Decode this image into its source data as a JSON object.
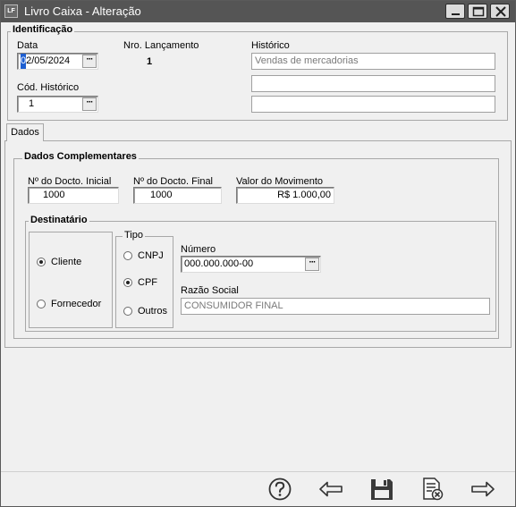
{
  "window": {
    "icon_text": "LF",
    "title": "Livro Caixa - Alteração",
    "controls": [
      "minimize-icon",
      "maximize-icon",
      "close-icon"
    ]
  },
  "identificacao": {
    "group_title": "Identificação",
    "data_label": "Data",
    "data_first": "0",
    "data_rest": "2/05/2024",
    "lancamento_label": "Nro. Lançamento",
    "lancamento_value": "1",
    "historico_label": "Histórico",
    "historico_line1": "Vendas de mercadorias",
    "historico_line2": "",
    "historico_line3": "",
    "cod_historico_label": "Cód. Histórico",
    "cod_historico_value": "1",
    "lookup_label": "···"
  },
  "tabs": [
    {
      "label": "Dados",
      "active": true
    }
  ],
  "dados_complementares": {
    "group_title": "Dados Complementares",
    "docto_inicial_label": "Nº do Docto. Inicial",
    "docto_inicial_value": "1000",
    "docto_final_label": "Nº do Docto. Final",
    "docto_final_value": "1000",
    "valor_label": "Valor do Movimento",
    "valor_value": "R$ 1.000,00"
  },
  "destinatario": {
    "group_title": "Destinatário",
    "options": [
      {
        "label": "Cliente",
        "selected": true
      },
      {
        "label": "Fornecedor",
        "selected": false
      }
    ],
    "tipo_title": "Tipo",
    "tipo_options": [
      {
        "label": "CNPJ",
        "selected": false
      },
      {
        "label": "CPF",
        "selected": true
      },
      {
        "label": "Outros",
        "selected": false
      }
    ],
    "numero_label": "Número",
    "numero_value": "000.000.000-00",
    "razao_label": "Razão Social",
    "razao_value": "CONSUMIDOR FINAL"
  },
  "footer": {
    "buttons": [
      "help-icon",
      "back-arrow-icon",
      "save-icon",
      "cancel-document-icon",
      "forward-arrow-icon"
    ]
  },
  "colors": {
    "titlebar": "#555555",
    "window_bg": "#f0f0f0",
    "selection": "#1e5fd1"
  }
}
